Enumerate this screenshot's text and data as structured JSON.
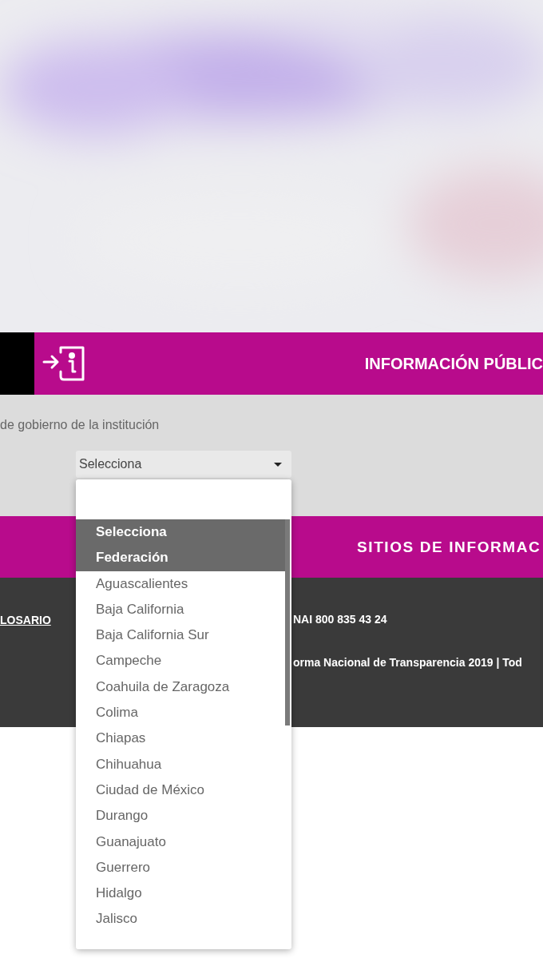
{
  "info_bar": {
    "title": "INFORMACIÓN PÚBLIC"
  },
  "filter": {
    "label": "de gobierno de la institución",
    "select": {
      "value": "Selecciona",
      "expanded": true
    }
  },
  "sites_bar": {
    "title": "SITIOS DE INFORMAC"
  },
  "footer": {
    "link": "LOSARIO",
    "phone": "NAI 800 835 43 24",
    "copyright": "orma Nacional de Transparencia 2019 | Tod"
  },
  "options": [
    {
      "label": "Selecciona",
      "selected": true
    },
    {
      "label": "Federación",
      "selected": true
    },
    {
      "label": "Aguascalientes",
      "selected": false
    },
    {
      "label": "Baja California",
      "selected": false
    },
    {
      "label": "Baja California Sur",
      "selected": false
    },
    {
      "label": "Campeche",
      "selected": false
    },
    {
      "label": "Coahuila de Zaragoza",
      "selected": false
    },
    {
      "label": "Colima",
      "selected": false
    },
    {
      "label": "Chiapas",
      "selected": false
    },
    {
      "label": "Chihuahua",
      "selected": false
    },
    {
      "label": "Ciudad de México",
      "selected": false
    },
    {
      "label": "Durango",
      "selected": false
    },
    {
      "label": "Guanajuato",
      "selected": false
    },
    {
      "label": "Guerrero",
      "selected": false
    },
    {
      "label": "Hidalgo",
      "selected": false
    },
    {
      "label": "Jalisco",
      "selected": false
    }
  ]
}
